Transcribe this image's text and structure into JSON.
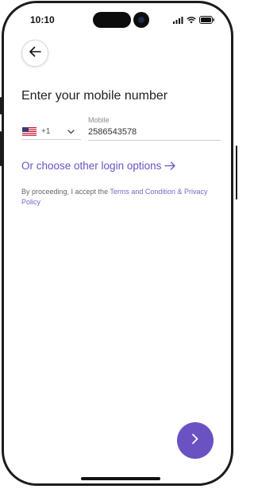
{
  "status_bar": {
    "time": "10:10"
  },
  "header": {
    "title": "Enter your mobile number"
  },
  "phone_input": {
    "country_code": "+1",
    "country_flag": "us-flag",
    "mobile_label": "Mobile",
    "mobile_value": "2586543578"
  },
  "login_options": {
    "label": "Or choose other login options"
  },
  "legal": {
    "prefix": "By proceeding, I accept the ",
    "link_text": "Terms and Condition & Privacy Policy"
  },
  "colors": {
    "accent": "#6a52c3",
    "link": "#7a66c8"
  },
  "icons": {
    "back": "arrow-left-icon",
    "forward": "chevron-right-icon",
    "dropdown": "chevron-down-icon",
    "login_arrow": "arrow-right-icon"
  }
}
